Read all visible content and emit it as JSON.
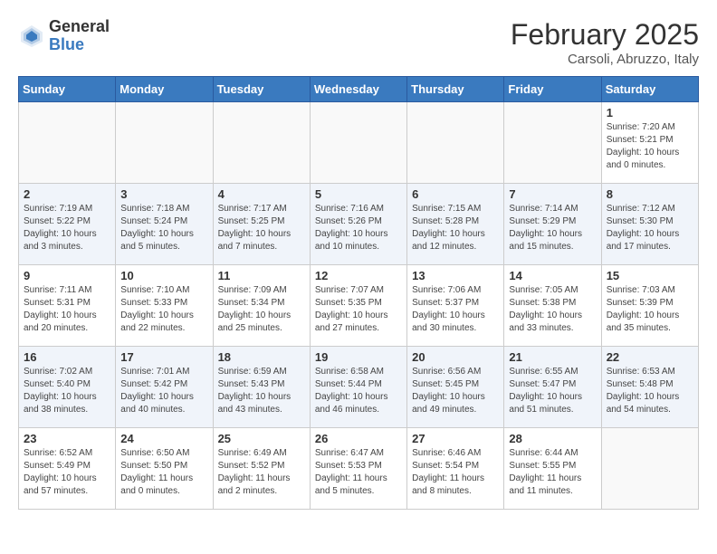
{
  "header": {
    "logo_general": "General",
    "logo_blue": "Blue",
    "title": "February 2025",
    "location": "Carsoli, Abruzzo, Italy"
  },
  "weekdays": [
    "Sunday",
    "Monday",
    "Tuesday",
    "Wednesday",
    "Thursday",
    "Friday",
    "Saturday"
  ],
  "weeks": [
    [
      {
        "day": "",
        "info": ""
      },
      {
        "day": "",
        "info": ""
      },
      {
        "day": "",
        "info": ""
      },
      {
        "day": "",
        "info": ""
      },
      {
        "day": "",
        "info": ""
      },
      {
        "day": "",
        "info": ""
      },
      {
        "day": "1",
        "info": "Sunrise: 7:20 AM\nSunset: 5:21 PM\nDaylight: 10 hours\nand 0 minutes."
      }
    ],
    [
      {
        "day": "2",
        "info": "Sunrise: 7:19 AM\nSunset: 5:22 PM\nDaylight: 10 hours\nand 3 minutes."
      },
      {
        "day": "3",
        "info": "Sunrise: 7:18 AM\nSunset: 5:24 PM\nDaylight: 10 hours\nand 5 minutes."
      },
      {
        "day": "4",
        "info": "Sunrise: 7:17 AM\nSunset: 5:25 PM\nDaylight: 10 hours\nand 7 minutes."
      },
      {
        "day": "5",
        "info": "Sunrise: 7:16 AM\nSunset: 5:26 PM\nDaylight: 10 hours\nand 10 minutes."
      },
      {
        "day": "6",
        "info": "Sunrise: 7:15 AM\nSunset: 5:28 PM\nDaylight: 10 hours\nand 12 minutes."
      },
      {
        "day": "7",
        "info": "Sunrise: 7:14 AM\nSunset: 5:29 PM\nDaylight: 10 hours\nand 15 minutes."
      },
      {
        "day": "8",
        "info": "Sunrise: 7:12 AM\nSunset: 5:30 PM\nDaylight: 10 hours\nand 17 minutes."
      }
    ],
    [
      {
        "day": "9",
        "info": "Sunrise: 7:11 AM\nSunset: 5:31 PM\nDaylight: 10 hours\nand 20 minutes."
      },
      {
        "day": "10",
        "info": "Sunrise: 7:10 AM\nSunset: 5:33 PM\nDaylight: 10 hours\nand 22 minutes."
      },
      {
        "day": "11",
        "info": "Sunrise: 7:09 AM\nSunset: 5:34 PM\nDaylight: 10 hours\nand 25 minutes."
      },
      {
        "day": "12",
        "info": "Sunrise: 7:07 AM\nSunset: 5:35 PM\nDaylight: 10 hours\nand 27 minutes."
      },
      {
        "day": "13",
        "info": "Sunrise: 7:06 AM\nSunset: 5:37 PM\nDaylight: 10 hours\nand 30 minutes."
      },
      {
        "day": "14",
        "info": "Sunrise: 7:05 AM\nSunset: 5:38 PM\nDaylight: 10 hours\nand 33 minutes."
      },
      {
        "day": "15",
        "info": "Sunrise: 7:03 AM\nSunset: 5:39 PM\nDaylight: 10 hours\nand 35 minutes."
      }
    ],
    [
      {
        "day": "16",
        "info": "Sunrise: 7:02 AM\nSunset: 5:40 PM\nDaylight: 10 hours\nand 38 minutes."
      },
      {
        "day": "17",
        "info": "Sunrise: 7:01 AM\nSunset: 5:42 PM\nDaylight: 10 hours\nand 40 minutes."
      },
      {
        "day": "18",
        "info": "Sunrise: 6:59 AM\nSunset: 5:43 PM\nDaylight: 10 hours\nand 43 minutes."
      },
      {
        "day": "19",
        "info": "Sunrise: 6:58 AM\nSunset: 5:44 PM\nDaylight: 10 hours\nand 46 minutes."
      },
      {
        "day": "20",
        "info": "Sunrise: 6:56 AM\nSunset: 5:45 PM\nDaylight: 10 hours\nand 49 minutes."
      },
      {
        "day": "21",
        "info": "Sunrise: 6:55 AM\nSunset: 5:47 PM\nDaylight: 10 hours\nand 51 minutes."
      },
      {
        "day": "22",
        "info": "Sunrise: 6:53 AM\nSunset: 5:48 PM\nDaylight: 10 hours\nand 54 minutes."
      }
    ],
    [
      {
        "day": "23",
        "info": "Sunrise: 6:52 AM\nSunset: 5:49 PM\nDaylight: 10 hours\nand 57 minutes."
      },
      {
        "day": "24",
        "info": "Sunrise: 6:50 AM\nSunset: 5:50 PM\nDaylight: 11 hours\nand 0 minutes."
      },
      {
        "day": "25",
        "info": "Sunrise: 6:49 AM\nSunset: 5:52 PM\nDaylight: 11 hours\nand 2 minutes."
      },
      {
        "day": "26",
        "info": "Sunrise: 6:47 AM\nSunset: 5:53 PM\nDaylight: 11 hours\nand 5 minutes."
      },
      {
        "day": "27",
        "info": "Sunrise: 6:46 AM\nSunset: 5:54 PM\nDaylight: 11 hours\nand 8 minutes."
      },
      {
        "day": "28",
        "info": "Sunrise: 6:44 AM\nSunset: 5:55 PM\nDaylight: 11 hours\nand 11 minutes."
      },
      {
        "day": "",
        "info": ""
      }
    ]
  ]
}
